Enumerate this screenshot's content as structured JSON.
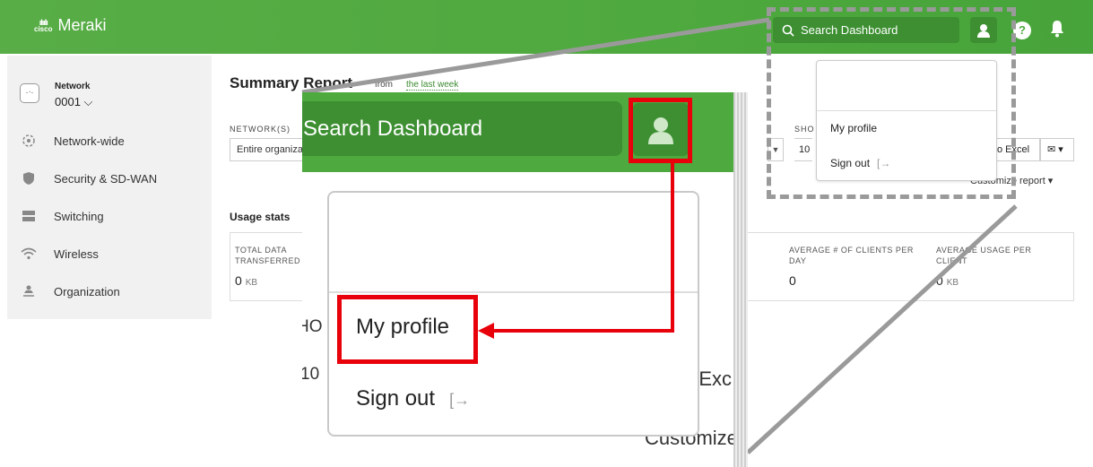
{
  "app": {
    "brand_small": "cisco",
    "brand_name": "Meraki"
  },
  "topbar": {
    "search_placeholder": "Search Dashboard",
    "help_glyph": "?",
    "icons": [
      "search-icon",
      "user-avatar-icon",
      "help-icon",
      "bell-icon"
    ]
  },
  "sidebar": {
    "network_label": "Network",
    "network_value": "0001 ⌵",
    "items": [
      {
        "label": "Network-wide",
        "icon": "network-wide-icon"
      },
      {
        "label": "Security & SD-WAN",
        "icon": "shield-icon"
      },
      {
        "label": "Switching",
        "icon": "switch-icon"
      },
      {
        "label": "Wireless",
        "icon": "wifi-icon"
      },
      {
        "label": "Organization",
        "icon": "organization-icon"
      }
    ]
  },
  "main": {
    "title": "Summary Report",
    "subtitle_prefix": "from",
    "subtitle_link": "the last week",
    "networks_label": "NETWORK(S)",
    "networks_value": "Entire organization",
    "show_label": "SHO",
    "show_value": "10",
    "export_label": "o Excel",
    "mail_label": "✉ ▾",
    "customize_label": "Customize report ▾",
    "usage_title": "Usage stats",
    "stats": [
      {
        "label": "TOTAL DATA TRANSFERRED",
        "value": "0",
        "unit": "KB"
      },
      {
        "label": "AVERAGE # OF CLIENTS PER DAY",
        "value": "0",
        "unit": ""
      },
      {
        "label": "AVERAGE USAGE PER CLIENT",
        "value": "0",
        "unit": "KB"
      }
    ]
  },
  "user_menu": {
    "items": [
      {
        "label": "My profile"
      },
      {
        "label": "Sign out",
        "icon": "sign-out-icon"
      }
    ]
  },
  "zoom": {
    "search_text": "Search Dashboard",
    "item1": "My profile",
    "item2": "Sign out",
    "bg_show": "HO",
    "bg_ten": "10",
    "bg_excel": "o Exc",
    "bg_customize": "Customize"
  },
  "colors": {
    "topbar_green": "#4ea93e",
    "dark_green": "#3d8f32",
    "highlight_red": "#e8000b",
    "dash_gray": "#9a9a9a"
  }
}
